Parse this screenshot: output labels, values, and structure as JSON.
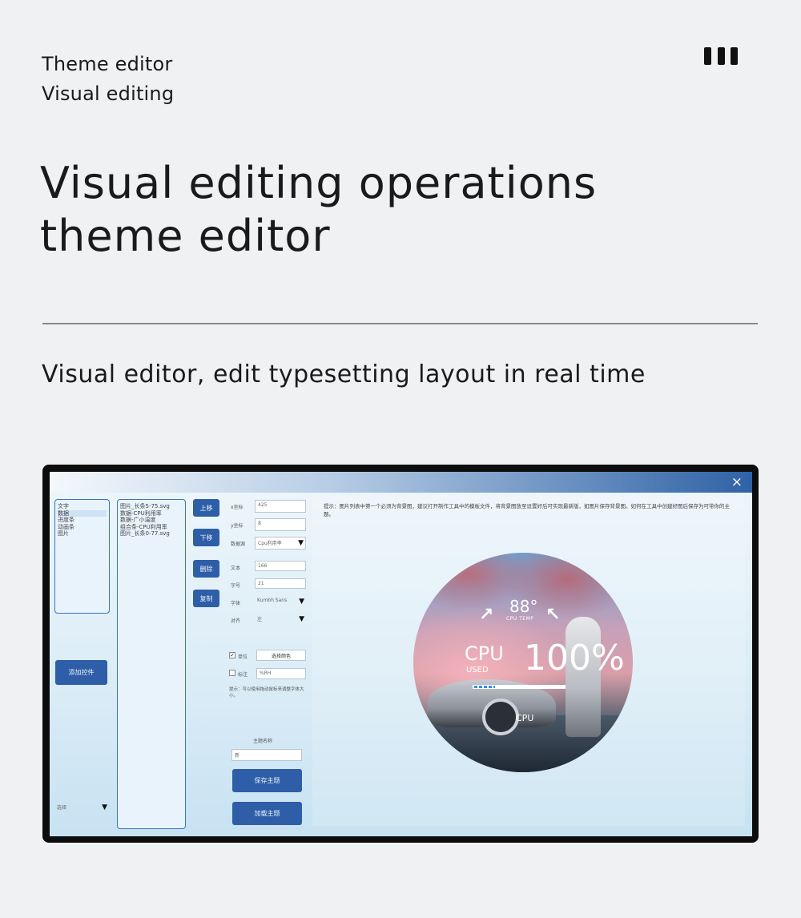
{
  "header": {
    "eyebrow_line1": "Theme editor",
    "eyebrow_line2": "Visual editing",
    "headline_line1": "Visual editing operations",
    "headline_line2": "theme editor",
    "subline": "Visual editor, edit typesetting layout in real time"
  },
  "editor": {
    "close_glyph": "×",
    "category_list": [
      "文字",
      "数据",
      "进度条",
      "动画条",
      "图片"
    ],
    "layer_list": [
      "图片_长条5-75.svg",
      "数据-CPU利用率",
      "数据-广小温度",
      "组合条-CPU利用率",
      "图片_长条0-77.svg"
    ],
    "add_control_button": "添加控件",
    "language_select": "选择",
    "move_up_button": "上移",
    "move_down_button": "下移",
    "delete_button": "删除",
    "copy_button": "复制",
    "field_labels": {
      "x": "x坐标",
      "y": "y坐标",
      "data_source": "数据源",
      "text": "文本",
      "font_size": "字号",
      "font": "字体",
      "align": "对齐"
    },
    "field_values": {
      "x": "425",
      "y": "8",
      "data_source": "Cpu利用率",
      "text": "166",
      "font_size": "21",
      "font": "Kumbh Sans",
      "align": "左"
    },
    "unit_checkbox_label": "单位",
    "unit_checked": true,
    "choose_color_button": "选择颜色",
    "suffix_checkbox_label": "标注",
    "suffix_checked": false,
    "suffix_value": "%RH",
    "tip_text": "提示：可以使用拖动鼠标来调整字体大小。",
    "theme_name_label": "主题名称",
    "theme_name_value": "新",
    "save_theme_button": "保存主题",
    "load_theme_button": "加载主题",
    "notice": "提示：图片列表中第一个必须为背景图，建议打开制作工具中的模板文件，将背景图放至设置好后可实现最新版，如图片保存背景图。如何在工具中创建好图后保存为可带你的主题。"
  },
  "preview": {
    "temperature": "88°",
    "temperature_label": "CPU TEMP",
    "cpu_label": "CPU",
    "used_label": "USED",
    "usage_percent": "100%",
    "usage_value": 1.0,
    "bottom_label": "CPU"
  },
  "colors": {
    "accent": "#2f5ea8",
    "panel_border": "#3a74bd",
    "page_bg": "#f0f1f3"
  }
}
